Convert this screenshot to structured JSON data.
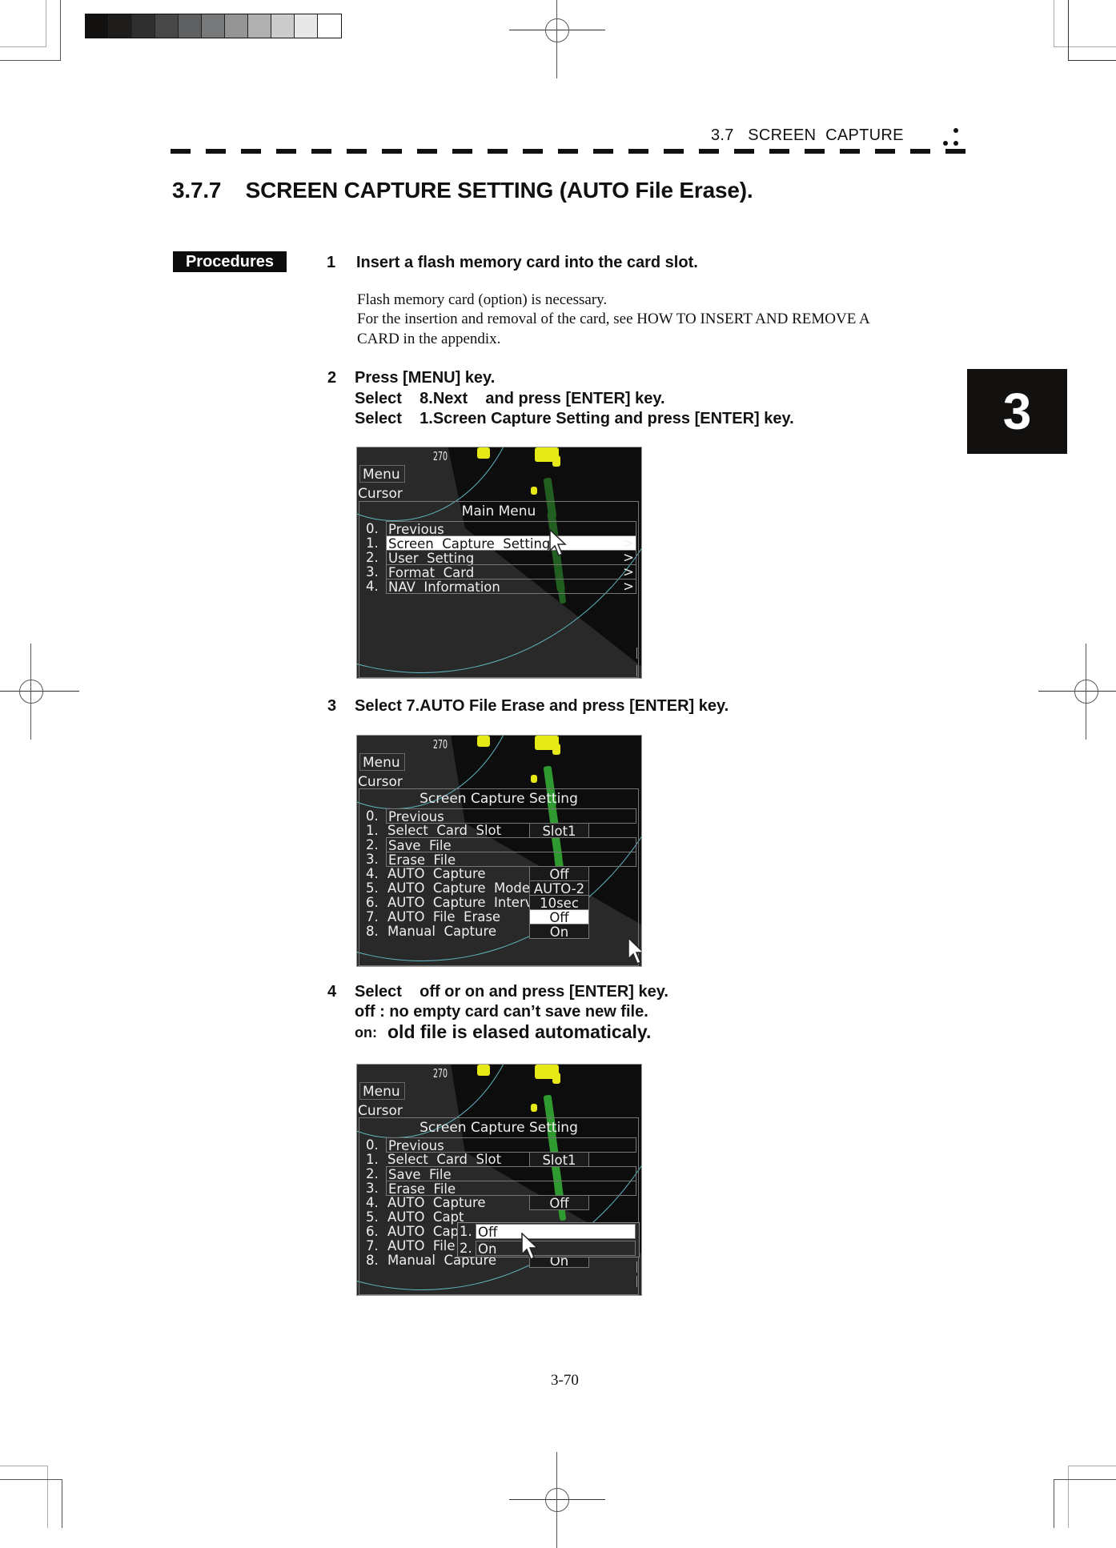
{
  "running_head": {
    "section": "3.7   SCREEN  CAPTURE"
  },
  "section_title": "3.7.7    SCREEN CAPTURE SETTING (AUTO File Erase).",
  "procedures_label": "Procedures",
  "chapter_tab": "3",
  "steps": [
    {
      "number": "1",
      "lines": [
        "Insert a flash memory card into the card slot."
      ],
      "notes": [
        "Flash memory card (option) is necessary.",
        "For the insertion and removal of the card, see HOW TO INSERT AND REMOVE A",
        "CARD in the appendix."
      ]
    },
    {
      "number": "2",
      "lines": [
        "Press [MENU] key.",
        "Select    8.Next    and press [ENTER] key.",
        "Select    1.Screen Capture Setting and press [ENTER] key."
      ]
    },
    {
      "number": "3",
      "lines": [
        "Select 7.AUTO File Erase and press [ENTER] key."
      ]
    },
    {
      "number": "4",
      "lines": [
        "Select    off or on and press [ENTER] key.",
        "off : no empty card can’t save new file.",
        "old file is elased automaticaly."
      ],
      "on_prefix": "on:"
    }
  ],
  "screens": {
    "common": {
      "bearing_label": "270",
      "menu_button": "Menu",
      "cursor_label": "Cursor"
    },
    "main_menu": {
      "title": "Main Menu",
      "selected_index": 1,
      "items": [
        {
          "num": "0.",
          "label": "Previous",
          "arrow": ""
        },
        {
          "num": "1.",
          "label": "Screen  Capture  Setting",
          "arrow": ">"
        },
        {
          "num": "2.",
          "label": "User  Setting",
          "arrow": ">"
        },
        {
          "num": "3.",
          "label": "Format  Card",
          "arrow": ">"
        },
        {
          "num": "4.",
          "label": "NAV  Information",
          "arrow": ">"
        }
      ]
    },
    "capture_setting": {
      "title": "Screen  Capture  Setting",
      "items": [
        {
          "num": "0.",
          "label": "Previous",
          "value": ""
        },
        {
          "num": "1.",
          "label": "Select  Card  Slot",
          "value": "Slot1"
        },
        {
          "num": "2.",
          "label": "Save  File",
          "value": ""
        },
        {
          "num": "3.",
          "label": "Erase  File",
          "value": ""
        },
        {
          "num": "4.",
          "label": "AUTO  Capture",
          "value": "Off"
        },
        {
          "num": "5.",
          "label": "AUTO  Capture  Mode",
          "value": "AUTO-2"
        },
        {
          "num": "6.",
          "label": "AUTO  Capture  Interval",
          "value": "10sec"
        },
        {
          "num": "7.",
          "label": "AUTO  File  Erase",
          "value": "Off"
        },
        {
          "num": "8.",
          "label": "Manual  Capture",
          "value": "On"
        }
      ],
      "selected_value_index": 7
    },
    "capture_setting_popup": {
      "title": "Screen  Capture  Setting",
      "items": [
        {
          "num": "0.",
          "label": "Previous",
          "value": ""
        },
        {
          "num": "1.",
          "label": "Select  Card  Slot",
          "value": "Slot1"
        },
        {
          "num": "2.",
          "label": "Save  File",
          "value": ""
        },
        {
          "num": "3.",
          "label": "Erase  File",
          "value": ""
        },
        {
          "num": "4.",
          "label": "AUTO  Capture",
          "value": "Off"
        },
        {
          "num": "5.",
          "label": "AUTO  Capt",
          "value": ""
        },
        {
          "num": "6.",
          "label": "AUTO  Capt",
          "value": ""
        },
        {
          "num": "7.",
          "label": "AUTO  File  Erase",
          "value": "Off"
        },
        {
          "num": "8.",
          "label": "Manual  Capture",
          "value": "On"
        }
      ],
      "popup_options": [
        {
          "num": "1.",
          "label": "Off"
        },
        {
          "num": "2.",
          "label": "On"
        }
      ],
      "popup_selected_index": 0
    }
  },
  "page_number": "3-70",
  "colors": {
    "screen_bg": "#2a2929",
    "radar_dark": "#0d0d0d",
    "echo_yellow": "#e7e917",
    "echo_green": "#2b8a2b",
    "range_ring": "#5fb7c2",
    "highlight": "#ffffff"
  }
}
